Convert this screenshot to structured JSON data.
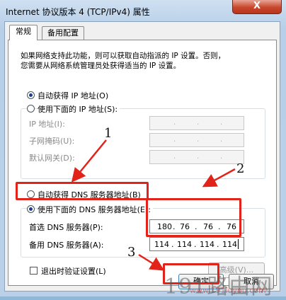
{
  "window": {
    "title": "Internet 协议版本 4 (TCP/IPv4) 属性",
    "close_glyph": "X"
  },
  "tabs": [
    {
      "label": "常规",
      "active": true
    },
    {
      "label": "备用配置",
      "active": false
    }
  ],
  "description": {
    "line1": "如果网络支持此功能，则可以获取自动指派的 IP 设置。否则，",
    "line2": "您需要从网络系统管理员处获得适当的 IP 设置。"
  },
  "ip": {
    "auto_label": "自动获得 IP 地址(O)",
    "auto_selected": true,
    "manual_label": "使用下面的 IP 地址(S):",
    "manual_selected": false,
    "address_label": "IP 地址(I):",
    "mask_label": "子网掩码(U):",
    "gateway_label": "默认网关(D):"
  },
  "dns": {
    "auto_label": "自动获得 DNS 服务器地址(B)",
    "auto_selected": false,
    "manual_label": "使用下面的 DNS 服务器地址(E):",
    "manual_selected": true,
    "preferred_label": "首选 DNS 服务器(P):",
    "preferred_octets": [
      "180",
      "76",
      "76",
      "76"
    ],
    "alternate_label": "备用 DNS 服务器(A):",
    "alternate_octets": [
      "114",
      "114",
      "114",
      "114"
    ]
  },
  "validate": {
    "label": "退出时验证设置(L)",
    "checked": false
  },
  "buttons": {
    "advanced": "高级(V)...",
    "ok": "确定",
    "cancel": "取消"
  },
  "annotations": {
    "step1": "1",
    "step2": "2",
    "step3": "3",
    "highlight_color": "#e2231a"
  },
  "watermark": {
    "brand_digits": "191",
    "brand_chars": "路由网",
    "url": "www.191luyou.com"
  }
}
